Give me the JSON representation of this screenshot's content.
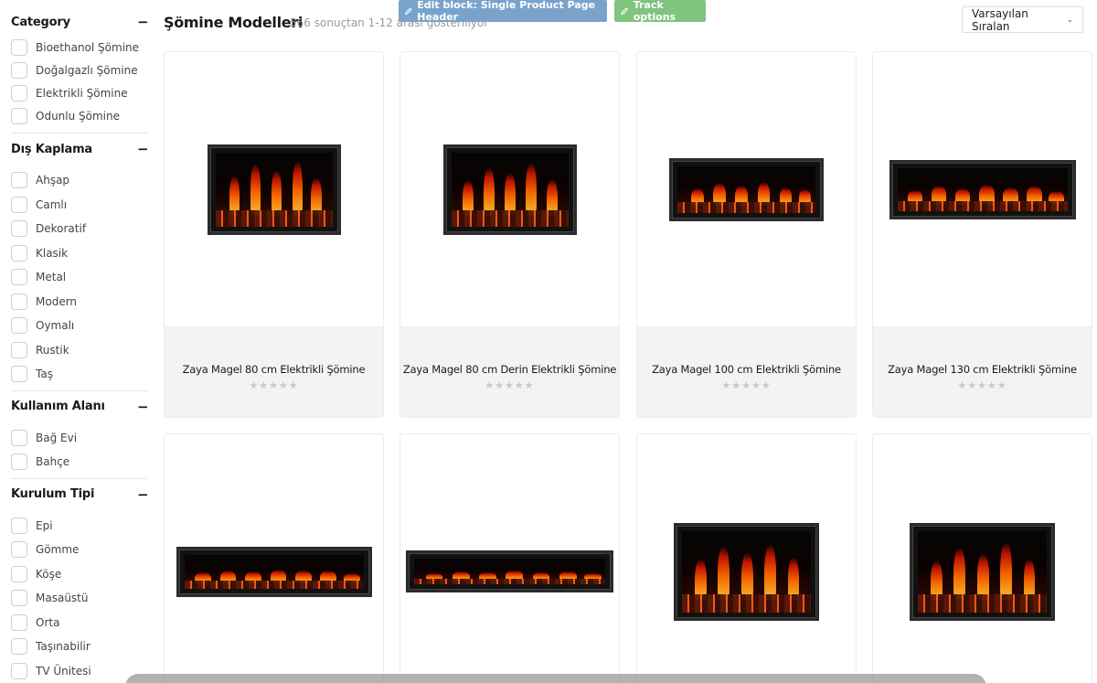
{
  "header": {
    "title": "Şömine Modelleri",
    "result_count": "566 sonuçtan 1-12 arası gösteriliyor",
    "admin_edit_label": "Edit block: Single Product Page Header",
    "admin_track_label": "Track options",
    "sort_label": "Varsayılan Sıralan"
  },
  "filters": {
    "category": {
      "title": "Category",
      "toggle": "−",
      "items": [
        "Bioethanol Şömine",
        "Doğalgazlı Şömine",
        "Elektrikli Şömine",
        "Odunlu Şömine"
      ]
    },
    "dis_kaplama": {
      "title": "Dış Kaplama",
      "toggle": "−",
      "items": [
        "Ahşap",
        "Camlı",
        "Dekoratif",
        "Klasik",
        "Metal",
        "Modern",
        "Oymalı",
        "Rustik",
        "Taş"
      ]
    },
    "kullanim_alani": {
      "title": "Kullanım Alanı",
      "toggle": "−",
      "items": [
        "Bağ Evi",
        "Bahçe"
      ]
    },
    "kurulum_tipi": {
      "title": "Kurulum Tipi",
      "toggle": "−",
      "items": [
        "Epi",
        "Gömme",
        "Köşe",
        "Masaüstü",
        "Orta",
        "Taşınabilir",
        "TV Ünitesi"
      ]
    }
  },
  "products": [
    {
      "name": "Zaya Magel 80 cm Elektrikli Şömine",
      "rating": "★★★★★"
    },
    {
      "name": "Zaya Magel 80 cm Derin Elektrikli Şömine",
      "rating": "★★★★★"
    },
    {
      "name": "Zaya Magel 100 cm Elektrikli Şömine",
      "rating": "★★★★★"
    },
    {
      "name": "Zaya Magel 130 cm Elektrikli Şömine",
      "rating": "★★★★★"
    },
    {
      "name": "",
      "rating": ""
    },
    {
      "name": "",
      "rating": ""
    },
    {
      "name": "",
      "rating": ""
    },
    {
      "name": "",
      "rating": ""
    }
  ],
  "icons": {
    "edit": "pencil-icon",
    "track": "pencil-icon",
    "sort": "chevron-down-icon"
  },
  "colors": {
    "admin_edit_bg": "#7aa3cc",
    "admin_track_bg": "#7fc47f",
    "card_info_bg": "#f3f3f3"
  }
}
